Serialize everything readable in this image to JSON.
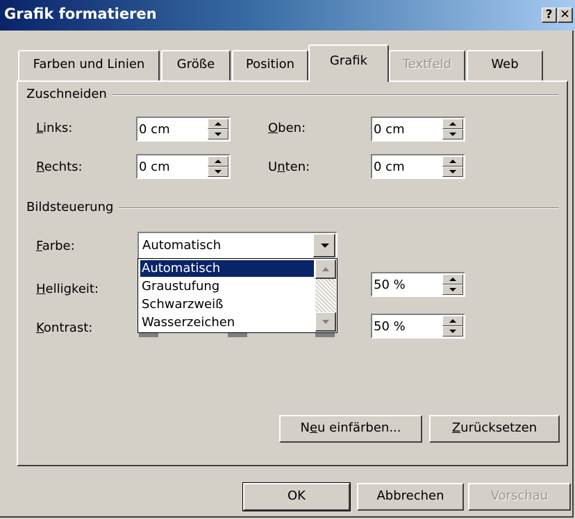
{
  "window": {
    "title": "Grafik formatieren",
    "help_label": "?",
    "close_label": "✕"
  },
  "tabs": [
    {
      "label": "Farben und Linien",
      "state": "normal"
    },
    {
      "label": "Größe",
      "state": "normal"
    },
    {
      "label": "Position",
      "state": "normal"
    },
    {
      "label": "Grafik",
      "state": "active"
    },
    {
      "label": "Textfeld",
      "state": "disabled"
    },
    {
      "label": "Web",
      "state": "normal"
    }
  ],
  "zuschneiden": {
    "group_label": "Zuschneiden",
    "links": {
      "label_ul": "L",
      "label_rest": "inks:",
      "value": "0 cm"
    },
    "oben": {
      "label_ul": "O",
      "label_rest": "ben:",
      "value": "0 cm"
    },
    "rechts": {
      "label_ul": "R",
      "label_rest": "echts:",
      "value": "0 cm"
    },
    "unten": {
      "label_pre": "U",
      "label_ul": "n",
      "label_rest": "ten:",
      "value": "0 cm"
    }
  },
  "bildsteuerung": {
    "group_label": "Bildsteuerung",
    "farbe": {
      "label_ul": "F",
      "label_rest": "arbe:",
      "value": "Automatisch"
    },
    "dropdown_options": [
      "Automatisch",
      "Graustufung",
      "Schwarzweiß",
      "Wasserzeichen"
    ],
    "selected_option": "Automatisch",
    "helligkeit": {
      "label_ul": "H",
      "label_rest": "elligkeit:",
      "value": "50 %"
    },
    "kontrast": {
      "label_ul": "K",
      "label_rest": "ontrast:",
      "value": "50 %"
    }
  },
  "panel_buttons": {
    "recolor": {
      "pre": "N",
      "ul": "e",
      "rest": "u einfärben..."
    },
    "reset": {
      "ul": "Z",
      "rest": "urücksetzen"
    }
  },
  "dialog_buttons": {
    "ok": "OK",
    "cancel": "Abbrechen",
    "preview": "Vorschau"
  }
}
